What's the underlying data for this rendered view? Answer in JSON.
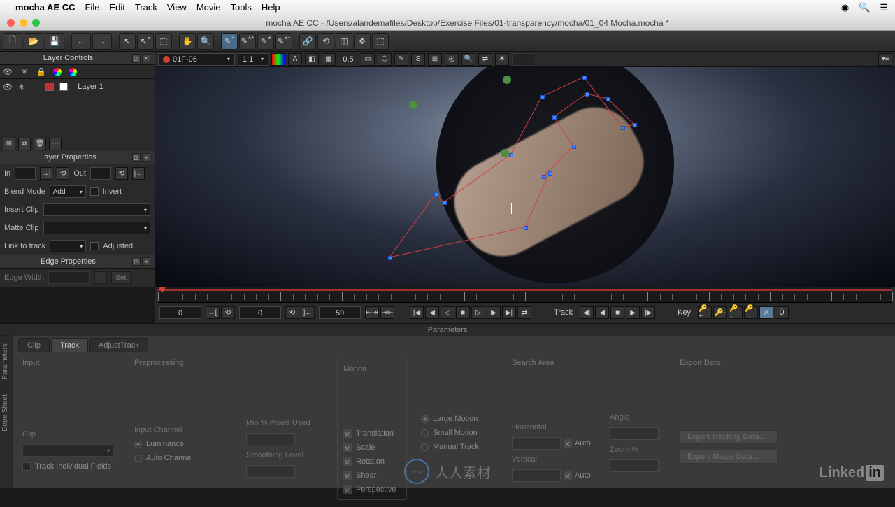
{
  "menubar": {
    "app": "mocha AE CC",
    "items": [
      "File",
      "Edit",
      "Track",
      "View",
      "Movie",
      "Tools",
      "Help"
    ]
  },
  "window_title": "mocha AE CC - /Users/alandemafiles/Desktop/Exercise Files/01-transparency/mocha/01_04 Mocha.mocha *",
  "clip_selector": "01F-06",
  "zoom_level": "1:1",
  "opacity_value": "0.5",
  "panels": {
    "layer_controls": "Layer Controls",
    "layer_properties": "Layer Properties",
    "edge_properties": "Edge Properties"
  },
  "layers": [
    {
      "name": "Layer 1",
      "color": "#c43030"
    }
  ],
  "props": {
    "in_label": "In",
    "out_label": "Out",
    "blend_label": "Blend Mode",
    "blend_value": "Add",
    "invert_label": "Invert",
    "insert_label": "Insert Clip",
    "matte_label": "Matte Clip",
    "link_label": "Link to track",
    "adjusted_label": "Adjusted",
    "edge_width_label": "Edge Width",
    "set_label": "Set"
  },
  "timeline": {
    "frame_left": "0",
    "frame_mid": "0",
    "frame_current": "59",
    "track_label": "Track",
    "key_label": "Key"
  },
  "params": {
    "header": "Parameters",
    "side_tabs": [
      "Parameters",
      "Dope Sheet"
    ],
    "tabs": [
      "Clip",
      "Track",
      "AdjustTrack"
    ],
    "active_tab": "Track",
    "input_hdr": "Input",
    "preproc_hdr": "Preprocessing",
    "motion_hdr": "Motion",
    "search_hdr": "Search Area",
    "export_hdr": "Export Data",
    "clip_label": "Clip",
    "track_individual": "Track Individual Fields",
    "input_channel": "Input Channel",
    "luminance": "Luminance",
    "auto_channel": "Auto Channel",
    "min_pixels": "Min % Pixels Used",
    "smoothing": "Smoothing Level",
    "motion_opts": [
      "Translation",
      "Scale",
      "Rotation",
      "Shear",
      "Perspective"
    ],
    "motion_modes": [
      "Large Motion",
      "Small Motion",
      "Manual Track"
    ],
    "horizontal": "Horizontal",
    "vertical": "Vertical",
    "angle": "Angle",
    "zoom_pct": "Zoom %",
    "auto": "Auto",
    "export_tracking": "Export Tracking Data...",
    "export_shape": "Export Shape Data..."
  },
  "watermark": "人人素材",
  "brand": {
    "name": "Linked",
    "suffix": "in"
  }
}
